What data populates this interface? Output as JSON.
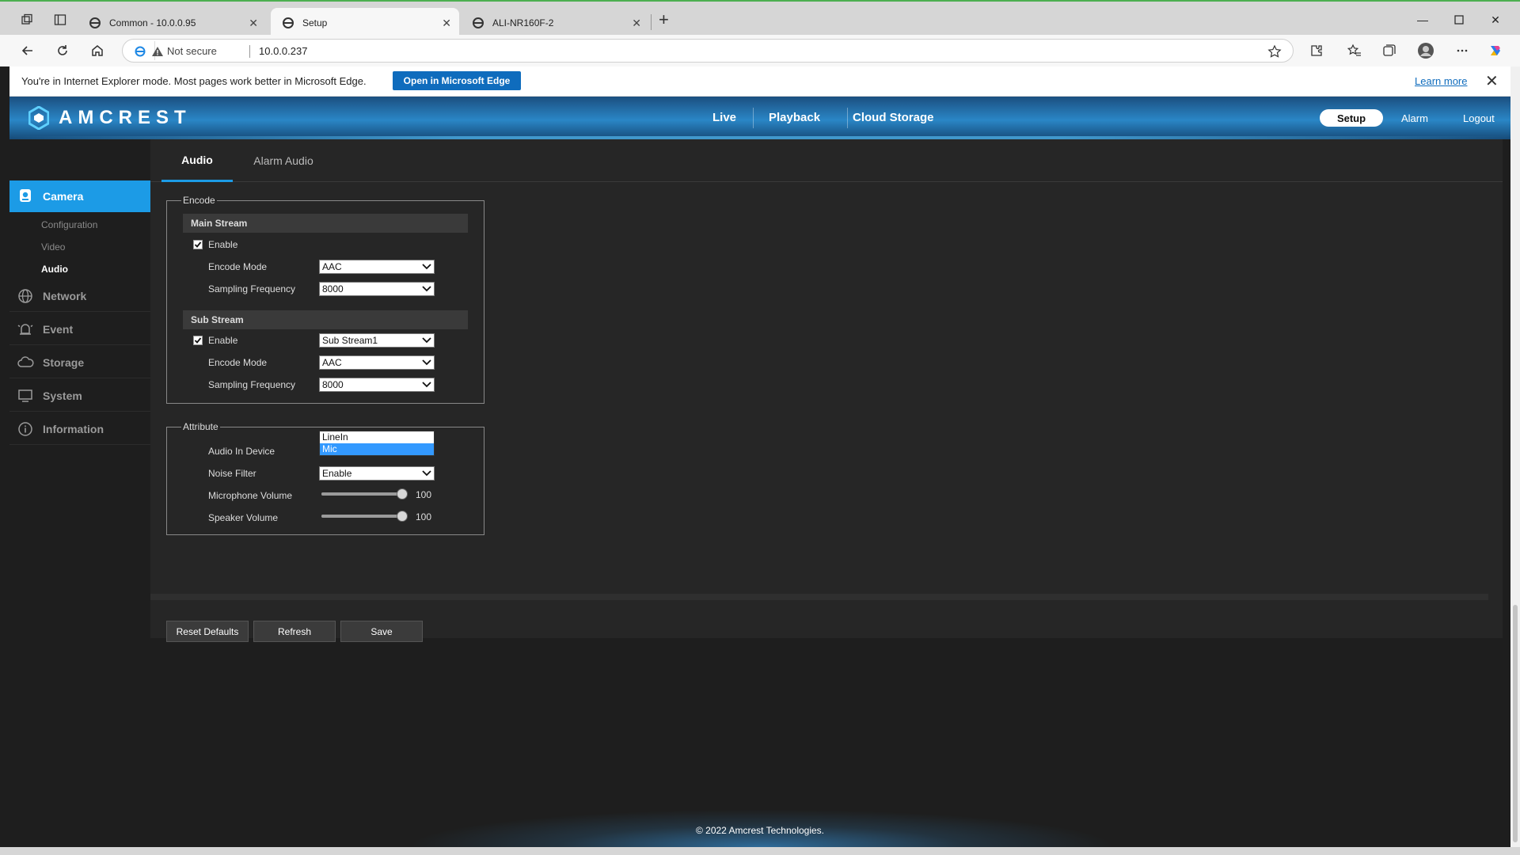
{
  "browser": {
    "tabs": [
      {
        "title": "Common - 10.0.0.95"
      },
      {
        "title": "Setup"
      },
      {
        "title": "ALI-NR160F-2"
      }
    ],
    "security": "Not secure",
    "url": "10.0.0.237",
    "ie_banner": {
      "message": "You're in Internet Explorer mode. Most pages work better in Microsoft Edge.",
      "open_label": "Open in Microsoft Edge",
      "learn_more": "Learn more"
    }
  },
  "header": {
    "brand": "AMCREST",
    "nav": [
      "Live",
      "Playback",
      "Cloud Storage"
    ],
    "setup": "Setup",
    "alarm": "Alarm",
    "logout": "Logout"
  },
  "sidebar": {
    "camera": "Camera",
    "camera_sub": [
      "Configuration",
      "Video",
      "Audio"
    ],
    "network": "Network",
    "event": "Event",
    "storage": "Storage",
    "system": "System",
    "information": "Information"
  },
  "subtabs": [
    "Audio",
    "Alarm Audio"
  ],
  "encode": {
    "legend": "Encode",
    "main": {
      "title": "Main Stream",
      "enable": "Enable",
      "encode_mode_label": "Encode Mode",
      "encode_mode": "AAC",
      "sampling_label": "Sampling Frequency",
      "sampling": "8000"
    },
    "sub": {
      "title": "Sub Stream",
      "enable": "Enable",
      "stream": "Sub Stream1",
      "encode_mode_label": "Encode Mode",
      "encode_mode": "AAC",
      "sampling_label": "Sampling Frequency",
      "sampling": "8000"
    }
  },
  "attribute": {
    "legend": "Attribute",
    "audio_in_label": "Audio In Device",
    "audio_in_options": [
      "LineIn",
      "Mic"
    ],
    "noise_filter_label": "Noise Filter",
    "noise_filter": "Enable",
    "mic_volume_label": "Microphone Volume",
    "mic_volume": "100",
    "speaker_volume_label": "Speaker Volume",
    "speaker_volume": "100"
  },
  "buttons": {
    "reset": "Reset Defaults",
    "refresh": "Refresh",
    "save": "Save"
  },
  "footer": "© 2022 Amcrest Technologies.",
  "colors": {
    "accent": "#1c9be6",
    "edge_blue": "#0f6cbd"
  }
}
